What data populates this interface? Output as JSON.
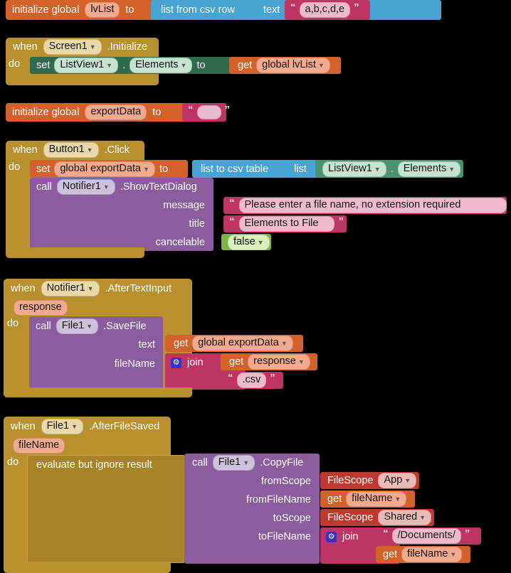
{
  "editor": {
    "name": "mit-app-inventor-blocks-editor",
    "background": "#000000"
  },
  "palette": {
    "variable_orange": "#D2622A",
    "event_gold": "#B8902E",
    "text_magenta": "#BF3466",
    "list_blue": "#49A4D2",
    "setter_green": "#2F6A4C",
    "getter_green": "#4C9170",
    "method_purple": "#8B5C9E",
    "logic_green": "#7CB342",
    "filescope_red": "#BE3A31"
  },
  "blocks": {
    "init_lvlist": {
      "keyword": "initialize global",
      "name": "lvList",
      "to": "to",
      "value_block": {
        "label": "list from csv row",
        "arg_label": "text",
        "text_value": "a,b,c,d,e"
      }
    },
    "screen1_initialize": {
      "when": "when",
      "component": "Screen1",
      "event": ".Initialize",
      "do": "do",
      "body": {
        "set": "set",
        "component": "ListView1",
        "dot": ".",
        "property": "Elements",
        "to": "to",
        "value": {
          "get": "get",
          "variable": "global lvList"
        }
      }
    },
    "init_exportdata": {
      "keyword": "initialize global",
      "name": "exportData",
      "to": "to",
      "value_block": {
        "text_value": ""
      }
    },
    "button1_click": {
      "when": "when",
      "component": "Button1",
      "event": ".Click",
      "do": "do",
      "set_row": {
        "set": "set",
        "variable": "global exportData",
        "to": "to",
        "value": {
          "label": "list to csv table",
          "arg_label": "list",
          "getter": {
            "component": "ListView1",
            "dot": ".",
            "property": "Elements"
          }
        }
      },
      "call_row": {
        "call": "call",
        "component": "Notifier1",
        "method": ".ShowTextDialog",
        "params": [
          {
            "name": "message",
            "type": "text",
            "value": "Please enter a file name, no extension required"
          },
          {
            "name": "title",
            "type": "text",
            "value": "Elements to File"
          },
          {
            "name": "cancelable",
            "type": "logic",
            "value": "false"
          }
        ]
      }
    },
    "notifier1_aftertextinput": {
      "when": "when",
      "component": "Notifier1",
      "event": ".AfterTextInput",
      "param": "response",
      "do": "do",
      "call_row": {
        "call": "call",
        "component": "File1",
        "method": ".SaveFile",
        "params": [
          {
            "name": "text",
            "value_get": "global exportData"
          },
          {
            "name": "fileName",
            "join_label": "join",
            "join_items": [
              {
                "type": "get",
                "value": "response"
              },
              {
                "type": "text",
                "value": ".csv"
              }
            ]
          }
        ]
      }
    },
    "file1_afterfilesaved": {
      "when": "when",
      "component": "File1",
      "event": ".AfterFileSaved",
      "param": "fileName",
      "do": "do",
      "control_label": "evaluate but ignore result",
      "call_row": {
        "call": "call",
        "component": "File1",
        "method": ".CopyFile",
        "params": [
          {
            "name": "fromScope",
            "type": "filescope",
            "label": "FileScope",
            "value": "App"
          },
          {
            "name": "fromFileName",
            "type": "get",
            "get": "get",
            "value": "fileName"
          },
          {
            "name": "toScope",
            "type": "filescope",
            "label": "FileScope",
            "value": "Shared"
          },
          {
            "name": "toFileName",
            "type": "join",
            "join_label": "join",
            "join_items": [
              {
                "type": "text",
                "value": "/Documents/"
              },
              {
                "type": "get",
                "get": "get",
                "value": "fileName"
              }
            ]
          }
        ]
      }
    }
  },
  "icons": {
    "mutator_gear": "gear-icon",
    "dropdown_caret": "chevron-down-icon"
  }
}
